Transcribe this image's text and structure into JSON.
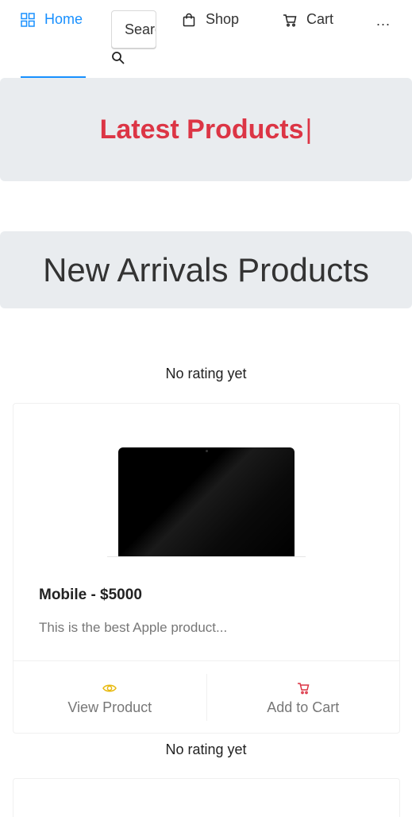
{
  "nav": {
    "home_label": "Home",
    "shop_label": "Shop",
    "cart_label": "Cart",
    "more_label": "...",
    "search_placeholder": "Search",
    "accent_color": "#1890ff"
  },
  "banners": {
    "latest_title": "Latest Products",
    "latest_caret": "|",
    "latest_color": "#dc3545",
    "new_arrivals_title": "New Arrivals Products"
  },
  "products": [
    {
      "rating_text": "No rating yet",
      "title": "Mobile - $5000",
      "description": "This is the best Apple product...",
      "view_label": "View Product",
      "add_label": "Add to Cart",
      "view_icon": "eye-icon",
      "add_icon": "cart-icon"
    },
    {
      "rating_text": "No rating yet"
    }
  ]
}
